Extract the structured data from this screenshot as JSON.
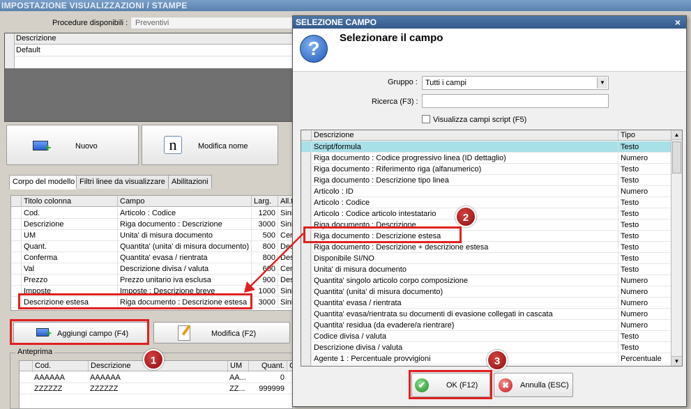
{
  "window": {
    "title": "IMPOSTAZIONE VISUALIZZAZIONI / STAMPE"
  },
  "procedure": {
    "label": "Procedure disponibili :",
    "value": "Preventivi"
  },
  "top_grid": {
    "header": "Descrizione",
    "rows": [
      "Default"
    ]
  },
  "buttons": {
    "nuovo": "Nuovo",
    "modifica_nome": "Modifica nome",
    "aggiungi": "Aggiungi campo (F4)",
    "modifica": "Modifica (F2)"
  },
  "tabs": [
    "Corpo del modello",
    "Filtri linee da visualizzare",
    "Abilitazioni"
  ],
  "columns_grid": {
    "headers": [
      "Titolo colonna",
      "Campo",
      "Larg.",
      "All.t"
    ],
    "rows": [
      [
        "Cod.",
        "Articolo : Codice",
        "1200",
        "Sinis"
      ],
      [
        "Descrizione",
        "Riga documento : Descrizione",
        "3000",
        "Sinis"
      ],
      [
        "UM",
        "Unita' di misura documento",
        "500",
        "Cent"
      ],
      [
        "Quant.",
        "Quantita' (unita' di misura documento)",
        "800",
        "Dest"
      ],
      [
        "Conferma",
        "Quantita' evasa / rientrata",
        "800",
        "Dest"
      ],
      [
        "Val",
        "Descrizione divisa / valuta",
        "600",
        "Cent"
      ],
      [
        "Prezzo",
        "Prezzo unitario iva esclusa",
        "900",
        "Dest"
      ],
      [
        "Imposte",
        "Imposte : Descrizione breve",
        "1000",
        "Sinis"
      ],
      [
        "Descrizione estesa",
        "Riga documento : Descrizione estesa",
        "3000",
        "Sinis"
      ]
    ]
  },
  "preview": {
    "label": "Anteprima",
    "headers": [
      "Cod.",
      "Descrizione",
      "UM",
      "Quant.",
      "C"
    ],
    "rows": [
      [
        "AAAAAA",
        "AAAAAA",
        "AA...",
        "0",
        ""
      ],
      [
        "ZZZZZZ",
        "ZZZZZZ",
        "ZZ...",
        "999999",
        ""
      ]
    ]
  },
  "dialog": {
    "title": "SELEZIONE CAMPO",
    "heading": "Selezionare il campo",
    "close": "×",
    "gruppo_label": "Gruppo :",
    "gruppo_value": "Tutti i campi",
    "ricerca_label": "Ricerca (F3) :",
    "ricerca_value": "",
    "checkbox_label": "Visualizza campi script (F5)",
    "list_headers": [
      "Descrizione",
      "Tipo"
    ],
    "list_rows": [
      [
        "Script/formula",
        "Testo"
      ],
      [
        "Riga documento : Codice progressivo linea (ID dettaglio)",
        "Numero"
      ],
      [
        "Riga documento : Riferimento riga (alfanumerico)",
        "Testo"
      ],
      [
        "Riga documento : Descrizione tipo linea",
        "Testo"
      ],
      [
        "Articolo : ID",
        "Numero"
      ],
      [
        "Articolo : Codice",
        "Testo"
      ],
      [
        "Articolo : Codice articolo intestatario",
        "Testo"
      ],
      [
        "Riga documento : Descrizione",
        "Testo"
      ],
      [
        "Riga documento : Descrizione estesa",
        "Testo"
      ],
      [
        "Riga documento : Descrizione + descrizione estesa",
        "Testo"
      ],
      [
        "Disponibile SI/NO",
        "Testo"
      ],
      [
        "Unita' di misura documento",
        "Testo"
      ],
      [
        "Quantita' singolo articolo corpo composizione",
        "Numero"
      ],
      [
        "Quantita' (unita' di misura documento)",
        "Numero"
      ],
      [
        "Quantita' evasa / rientrata",
        "Numero"
      ],
      [
        "Quantita' evasa/rientrata su documenti di evasione collegati in cascata",
        "Numero"
      ],
      [
        "Quantita' residua (da evadere/a rientrare)",
        "Numero"
      ],
      [
        "Codice divisa / valuta",
        "Testo"
      ],
      [
        "Descrizione divisa / valuta",
        "Testo"
      ],
      [
        "Agente 1 : Percentuale provvigioni",
        "Percentuale"
      ]
    ],
    "ok": "OK (F12)",
    "annulla": "Annulla (ESC)"
  },
  "callouts": [
    "1",
    "2",
    "3"
  ],
  "colors": {
    "accent_red": "#e02020",
    "selected_row": "#a8e0e8",
    "title_blue": "#33598a"
  }
}
